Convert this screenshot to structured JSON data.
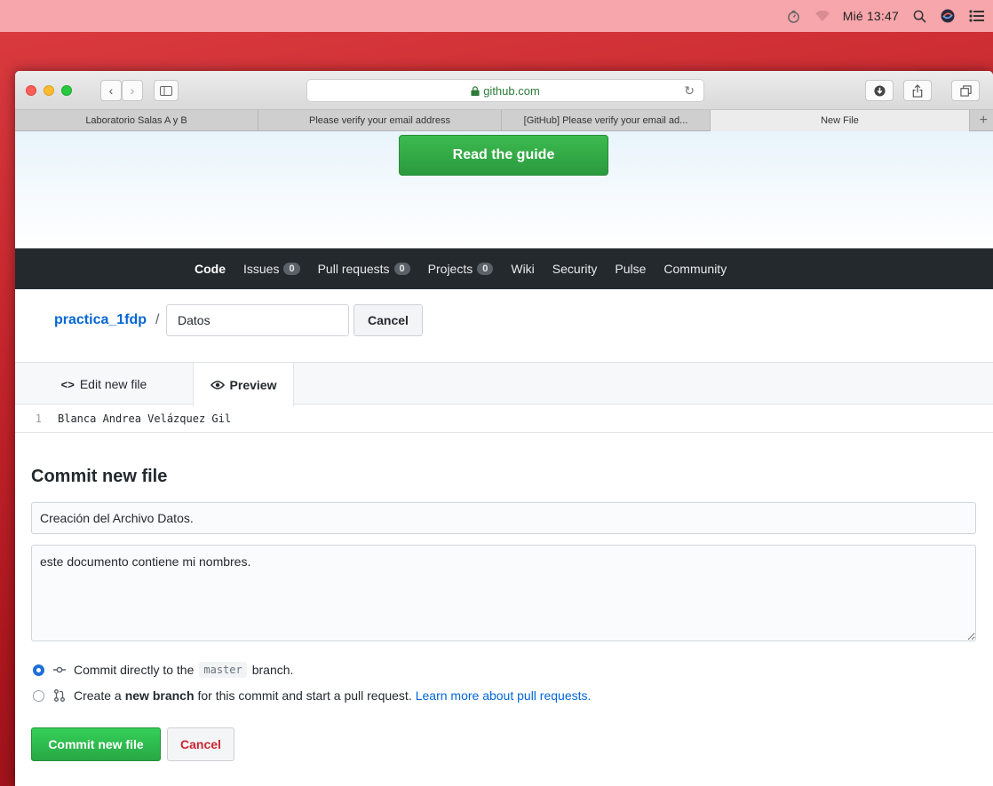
{
  "menubar": {
    "clock": "Mié 13:47"
  },
  "browser": {
    "address": "github.com",
    "tabs": [
      {
        "label": "Laboratorio Salas A y B"
      },
      {
        "label": "Please verify your email address"
      },
      {
        "label": "[GitHub] Please verify your email ad..."
      },
      {
        "label": "New File"
      }
    ],
    "new_tab": "+"
  },
  "hero": {
    "guide_button": "Read the guide"
  },
  "repo_nav": {
    "code": "Code",
    "issues": {
      "label": "Issues",
      "count": "0"
    },
    "pulls": {
      "label": "Pull requests",
      "count": "0"
    },
    "projects": {
      "label": "Projects",
      "count": "0"
    },
    "wiki": "Wiki",
    "security": "Security",
    "pulse": "Pulse",
    "community": "Community"
  },
  "file": {
    "repo_name": "practica_1fdp",
    "separator": "/",
    "file_name": "Datos",
    "cancel": "Cancel"
  },
  "editor": {
    "tab_edit": "Edit new file",
    "tab_preview": "Preview",
    "lines": [
      {
        "number": "1",
        "text": "Blanca Andrea Velázquez Gil"
      }
    ]
  },
  "commit": {
    "title": "Commit new file",
    "summary": "Creación del Archivo Datos.",
    "description": "este documento contiene mi nombres.",
    "option_direct": {
      "prefix": "Commit directly to the",
      "branch": "master",
      "suffix": "branch."
    },
    "option_new": {
      "prefix": "Create a",
      "bold": "new branch",
      "suffix": "for this commit and start a pull request.",
      "link": "Learn more about pull requests."
    },
    "submit": "Commit new file",
    "cancel": "Cancel"
  },
  "colors": {
    "primary_green": "#28a745",
    "link_blue": "#0366d6",
    "nav_dark": "#24292e",
    "danger_red": "#cb2431"
  }
}
